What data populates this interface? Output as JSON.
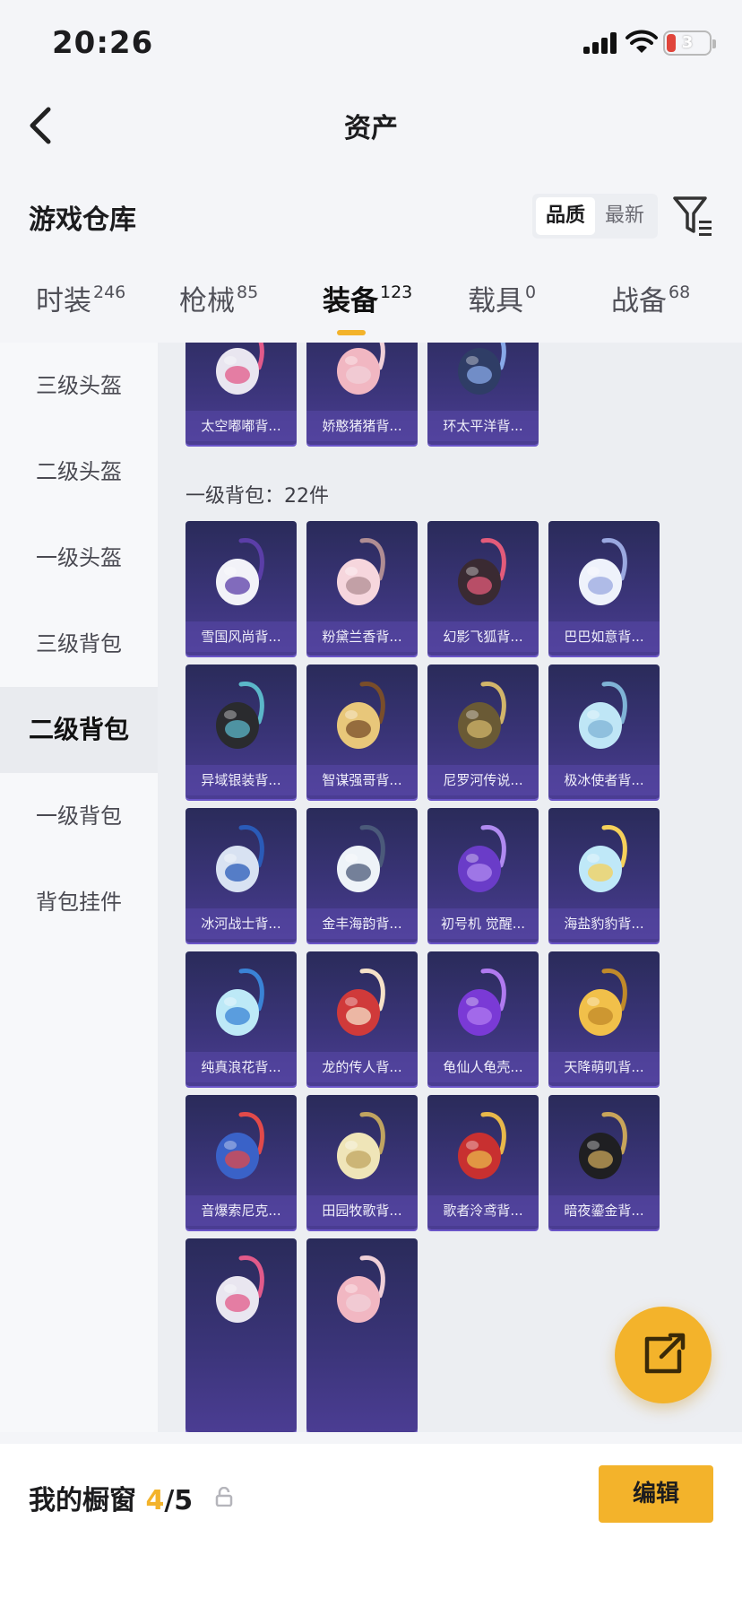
{
  "status_bar": {
    "time": "20:26",
    "battery": "3"
  },
  "nav": {
    "title": "资产"
  },
  "warehouse": {
    "title": "游戏仓库",
    "sort": {
      "active": "品质",
      "inactive": "最新"
    }
  },
  "tabs": [
    {
      "label": "时装",
      "count": "246"
    },
    {
      "label": "枪械",
      "count": "85"
    },
    {
      "label": "装备",
      "count": "123"
    },
    {
      "label": "载具",
      "count": "0"
    },
    {
      "label": "战备",
      "count": "68"
    }
  ],
  "sidebar": {
    "items": [
      "三级头盔",
      "二级头盔",
      "一级头盔",
      "三级背包",
      "二级背包",
      "一级背包",
      "背包挂件"
    ],
    "active_index": 4
  },
  "section": {
    "title": "一级背包：22件"
  },
  "top_row": [
    "太空嘟嘟背...",
    "娇憨猪猪背...",
    "环太平洋背..."
  ],
  "grid": [
    [
      "雪国风尚背...",
      "粉黛兰香背...",
      "幻影飞狐背...",
      "巴巴如意背..."
    ],
    [
      "异域银装背...",
      "智谋强哥背...",
      "尼罗河传说...",
      "极冰使者背..."
    ],
    [
      "冰河战士背...",
      "金丰海韵背...",
      "初号机 觉醒...",
      "海盐豹豹背..."
    ],
    [
      "纯真浪花背...",
      "龙的传人背...",
      "龟仙人龟壳...",
      "天降萌叽背..."
    ],
    [
      "音爆索尼克...",
      "田园牧歌背...",
      "歌者泠鸢背...",
      "暗夜鎏金背..."
    ]
  ],
  "bottom": {
    "showcase_label": "我的橱窗",
    "showcase_current": "4",
    "showcase_total": "/5",
    "edit_label": "编辑"
  },
  "colors": {
    "accent": "#f3b32b",
    "card_bg": "#3a3478"
  }
}
